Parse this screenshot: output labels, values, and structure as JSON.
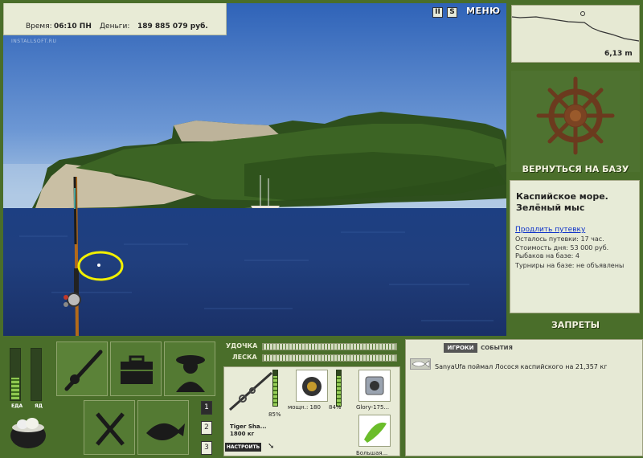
{
  "header": {
    "time_label": "Время:",
    "time_value": "06:10 ПН",
    "money_label": "Деньги:",
    "money_value": "189 885 079 руб.",
    "watermark": "INSTALLSOFT.RU",
    "pause_icon_text": "II",
    "settings_icon_text": "S",
    "menu_label": "МЕНЮ"
  },
  "depth": {
    "value_label": "6,13 m"
  },
  "base": {
    "return_label": "ВЕРНУТЬСЯ НА БАЗУ",
    "location_title": "Каспийское море. Зелёный мыс",
    "extend_link": "Продлить путевку",
    "lines": [
      "Осталось путевки: 17 час.",
      "Стоимость дня: 53 000 руб.",
      "Рыбаков на базе: 4",
      "Турниры на базе: не объявлены"
    ],
    "bans_label": "ЗАПРЕТЫ"
  },
  "status": {
    "food_label": "ЕДА",
    "food_level": 0.42,
    "poison_label": "ЯД",
    "poison_level": 0.0
  },
  "pages": [
    "1",
    "2",
    "3"
  ],
  "tackle": {
    "rod_label": "УДОЧКА",
    "line_label": "ЛЕСКА",
    "rod_name": "Tiger Sha...",
    "rod_weight": "1800 кг",
    "rod_percent": "85%",
    "reel_label": "мощн.: 180",
    "reel_percent": "84%",
    "line_item_label": "Glory-175...",
    "bait_label": "Большая...",
    "adjust_label": "НАСТРОИТЬ"
  },
  "events": {
    "tab_players": "ИГРОКИ",
    "tab_events": "СОБЫТИЯ",
    "message": "SanyaUfa поймал Лосося каспийского на 21,357 кг"
  },
  "colors": {
    "panel_green": "#4a6e2a",
    "panel_light": "#e7ebd7",
    "link_blue": "#0a2ec8",
    "highlight_yellow": "#f2f000"
  }
}
